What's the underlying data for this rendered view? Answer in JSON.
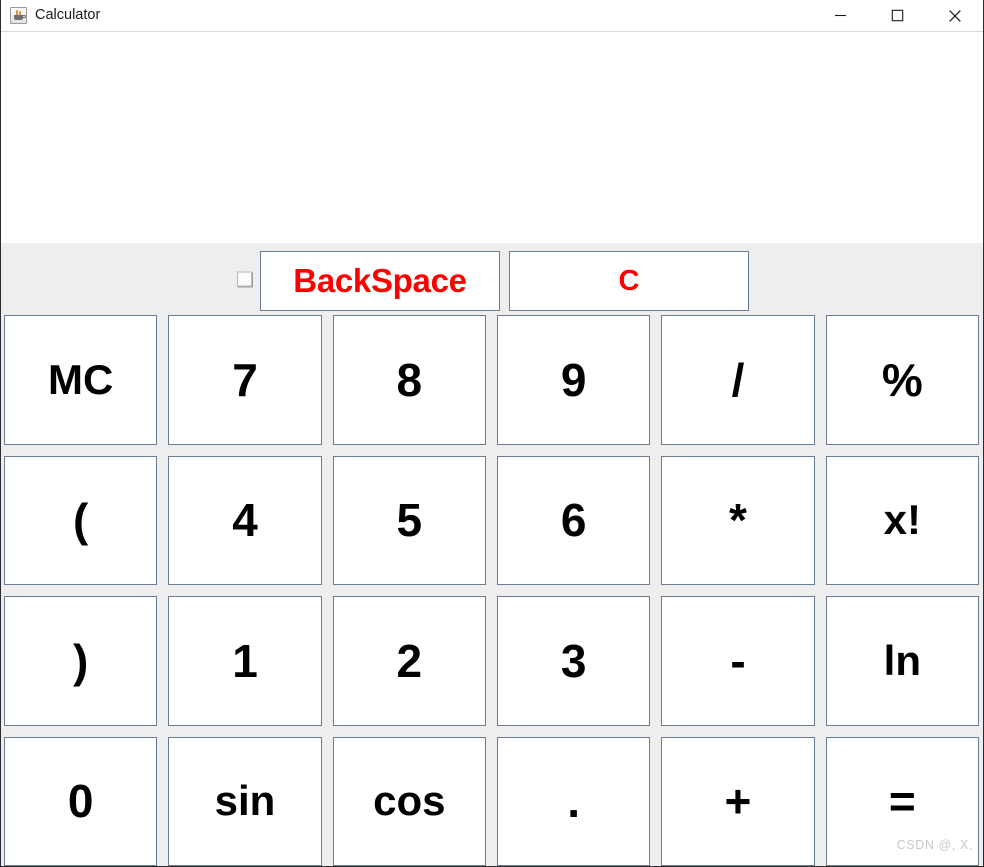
{
  "window": {
    "title": "Calculator",
    "app_icon": "java-coffee-cup-icon",
    "controls": {
      "minimize": "—",
      "maximize": "□",
      "close": "✕"
    }
  },
  "display": {
    "value": "",
    "placeholder": ""
  },
  "top_row": {
    "checkbox_label": "",
    "backspace_label": "BackSpace",
    "clear_label": "C"
  },
  "keypad": {
    "rows": [
      [
        {
          "label": "MC",
          "name": "key-mc"
        },
        {
          "label": "7",
          "name": "key-7"
        },
        {
          "label": "8",
          "name": "key-8"
        },
        {
          "label": "9",
          "name": "key-9"
        },
        {
          "label": "/",
          "name": "key-divide"
        },
        {
          "label": "%",
          "name": "key-percent"
        }
      ],
      [
        {
          "label": "(",
          "name": "key-open-paren"
        },
        {
          "label": "4",
          "name": "key-4"
        },
        {
          "label": "5",
          "name": "key-5"
        },
        {
          "label": "6",
          "name": "key-6"
        },
        {
          "label": "*",
          "name": "key-multiply"
        },
        {
          "label": "x!",
          "name": "key-factorial"
        }
      ],
      [
        {
          "label": ")",
          "name": "key-close-paren"
        },
        {
          "label": "1",
          "name": "key-1"
        },
        {
          "label": "2",
          "name": "key-2"
        },
        {
          "label": "3",
          "name": "key-3"
        },
        {
          "label": "-",
          "name": "key-minus"
        },
        {
          "label": "ln",
          "name": "key-ln"
        }
      ],
      [
        {
          "label": "0",
          "name": "key-0"
        },
        {
          "label": "sin",
          "name": "key-sin"
        },
        {
          "label": "cos",
          "name": "key-cos"
        },
        {
          "label": ".",
          "name": "key-decimal"
        },
        {
          "label": "+",
          "name": "key-plus"
        },
        {
          "label": "=",
          "name": "key-equals"
        }
      ]
    ]
  },
  "watermark": {
    "text": "CSDN @, X,"
  },
  "colors": {
    "accent_red": "#ff0000",
    "button_border": "#6b7c93",
    "panel_background": "#eeeeee",
    "button_background": "#ffffff",
    "text": "#000000"
  }
}
